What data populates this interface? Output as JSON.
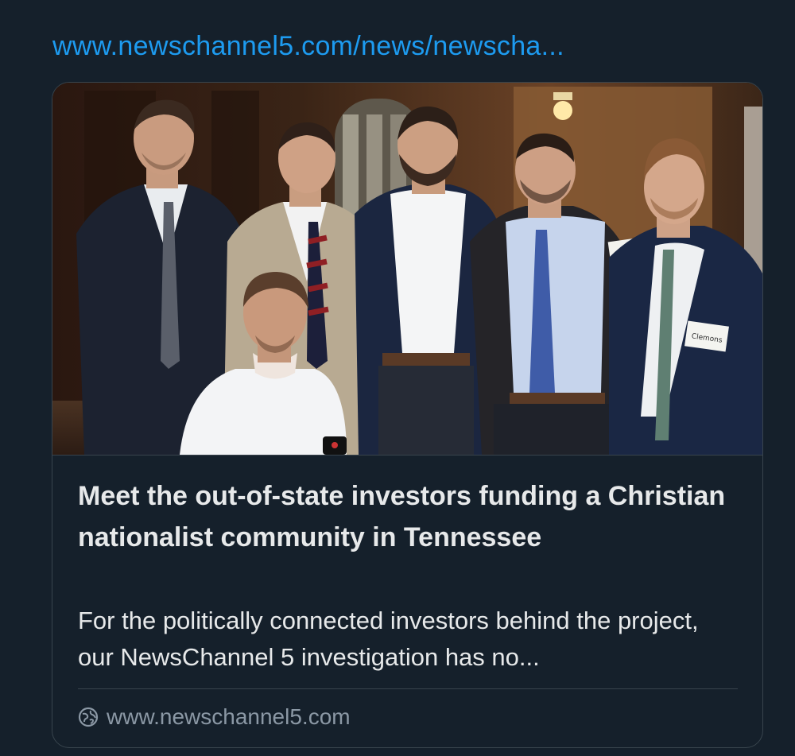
{
  "link": {
    "url_text": "www.newschannel5.com/news/newscha..."
  },
  "card": {
    "image": {
      "icon": "photo-of-group-of-men",
      "name_tags": [
        "Clemons"
      ]
    },
    "title": "Meet the out-of-state investors funding a Christian nationalist community in Tennessee",
    "description": "For the politically connected investors behind the project, our NewsChannel 5 investigation has no...",
    "domain": "www.newschannel5.com",
    "domain_icon": "link-globe-icon"
  },
  "colors": {
    "background": "#15202b",
    "link": "#1d9bf0",
    "text_primary": "#e7e9ea",
    "text_secondary": "#8b98a5",
    "border": "#38444d"
  }
}
